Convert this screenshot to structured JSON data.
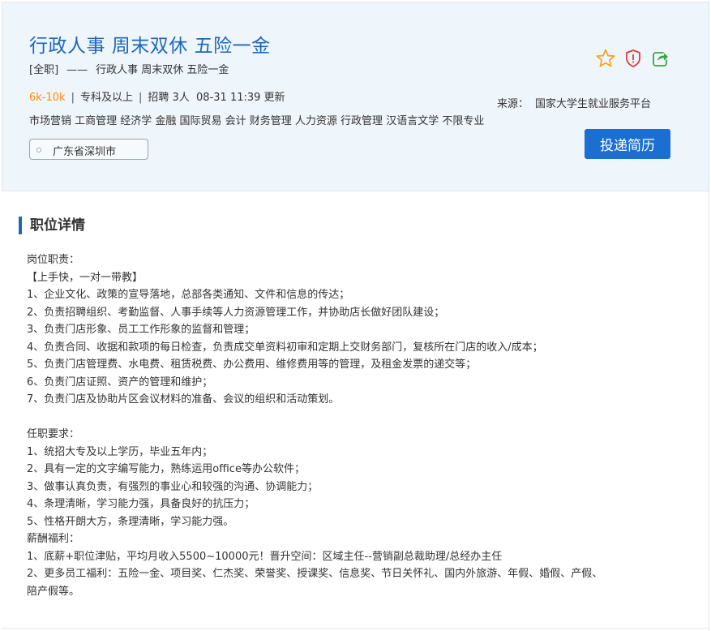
{
  "job": {
    "title": "行政人事 周末双休 五险一金",
    "type": "[全职]",
    "dash": "——",
    "subtitle": "行政人事 周末双休 五险一金",
    "salary": "6k-10k",
    "education": "专科及以上",
    "recruit": "招聘 3人",
    "updated": "08-31 11:39 更新",
    "majors": "市场营销 工商管理 经济学 金融 国际贸易 会计 财务管理 人力资源 行政管理 汉语言文学 不限专业",
    "location": "广东省深圳市",
    "source_label": "来源：",
    "source": "国家大学生就业服务平台",
    "apply_label": "投递简历"
  },
  "icons": {
    "favorite": "star-icon",
    "report": "shield-icon",
    "share": "share-icon",
    "colors": {
      "star": "#f5a623",
      "shield": "#e03a3a",
      "share": "#3aa34a"
    }
  },
  "details": {
    "section_title": "职位详情",
    "lines": [
      "岗位职责：",
      "【上手快，一对一带教】",
      "1、企业文化、政策的宣导落地，总部各类通知、文件和信息的传达；",
      "2、负责招聘组织、考勤监督、人事手续等人力资源管理工作，并协助店长做好团队建设；",
      "3、负责门店形象、员工工作形象的监督和管理；",
      "4、负责合同、收据和款项的每日检查，负责成交单资料初审和定期上交财务部门，复核所在门店的收入/成本；",
      "5、负责门店管理费、水电费、租赁税费、办公费用、维修费用等的管理，及租金发票的递交等；",
      "6、负责门店证照、资产的管理和维护；",
      "7、负责门店及协助片区会议材料的准备、会议的组织和活动策划。",
      "",
      "任职要求：",
      "1、统招大专及以上学历，毕业五年内；",
      "2、具有一定的文字编写能力，熟练运用office等办公软件；",
      "3、做事认真负责，有强烈的事业心和较强的沟通、协调能力；",
      "4、条理清晰，学习能力强，具备良好的抗压力；",
      "5、性格开朗大方，条理清晰，学习能力强。",
      "薪酬福利：",
      "1、底薪+职位津贴，平均月收入5500~10000元！晋升空间：区域主任--营销副总裁助理/总经办主任",
      "2、更多员工福利：五险一金、项目奖、仁杰奖、荣誉奖、授课奖、信息奖、节日关怀礼、国内外旅游、年假、婚假、产假、",
      "陪产假等。"
    ]
  }
}
